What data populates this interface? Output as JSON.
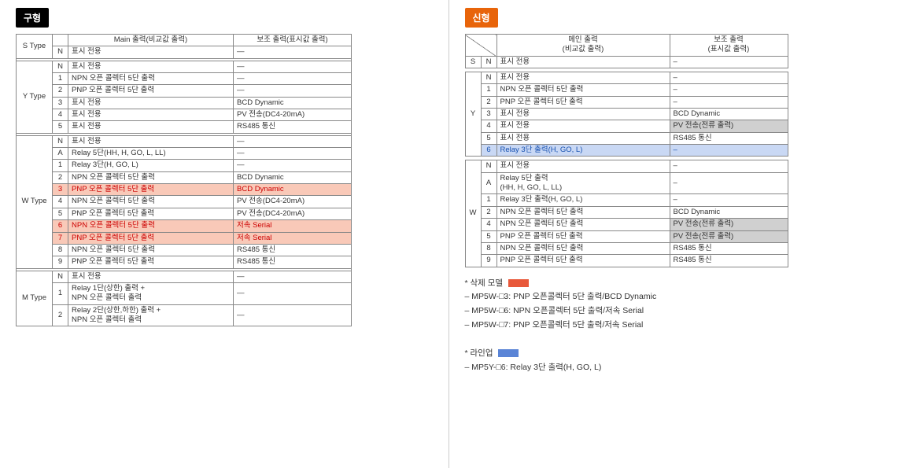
{
  "left": {
    "badge": "구형",
    "header": {
      "main": "Main 출력(비교값 출력)",
      "sub": "보조 출력(표시값 출력)"
    },
    "groups": [
      {
        "type": "S Type",
        "rows": [
          {
            "code": "N",
            "main": "표시 전용",
            "sub": "—"
          }
        ]
      },
      {
        "type": "Y Type",
        "rows": [
          {
            "code": "N",
            "main": "표시 전용",
            "sub": "—"
          },
          {
            "code": "1",
            "main": "NPN 오픈 콜렉터 5단 출력",
            "sub": "—"
          },
          {
            "code": "2",
            "main": "PNP 오픈 콜렉터 5단 출력",
            "sub": "—"
          },
          {
            "code": "3",
            "main": "표시 전용",
            "sub": "BCD Dynamic"
          },
          {
            "code": "4",
            "main": "표시 전용",
            "sub": "PV 전송(DC4-20mA)"
          },
          {
            "code": "5",
            "main": "표시 전용",
            "sub": "RS485 통신"
          }
        ]
      },
      {
        "type": "W Type",
        "rows": [
          {
            "code": "N",
            "main": "표시 전용",
            "sub": "—"
          },
          {
            "code": "A",
            "main": "Relay 5단(HH, H, GO, L, LL)",
            "sub": "—"
          },
          {
            "code": "1",
            "main": "Relay 3단(H, GO, L)",
            "sub": "—"
          },
          {
            "code": "2",
            "main": "NPN 오픈 콜렉터 5단 출력",
            "sub": "BCD Dynamic"
          },
          {
            "code": "3",
            "main": "PNP 오픈 콜렉터 5단 출력",
            "sub": "BCD Dynamic",
            "hl": "red"
          },
          {
            "code": "4",
            "main": "NPN 오픈 콜렉터 5단 출력",
            "sub": "PV 전송(DC4-20mA)"
          },
          {
            "code": "5",
            "main": "PNP 오픈 콜렉터 5단 출력",
            "sub": "PV 전송(DC4-20mA)"
          },
          {
            "code": "6",
            "main": "NPN 오픈 콜렉터 5단 출력",
            "sub": "저속 Serial",
            "hl": "red"
          },
          {
            "code": "7",
            "main": "PNP 오픈 콜렉터 5단 출력",
            "sub": "저속 Serial",
            "hl": "red"
          },
          {
            "code": "8",
            "main": "NPN 오픈 콜렉터 5단 출력",
            "sub": "RS485 통신"
          },
          {
            "code": "9",
            "main": "PNP 오픈 콜렉터 5단 출력",
            "sub": "RS485 통신"
          }
        ]
      },
      {
        "type": "M Type",
        "rows": [
          {
            "code": "N",
            "main": "표시 전용",
            "sub": "—"
          },
          {
            "code": "1",
            "main": "Relay 1단(상한) 출력 +\nNPN 오픈 콜렉터 출력",
            "sub": "—"
          },
          {
            "code": "2",
            "main": "Relay 2단(상한,하한) 출력 +\nNPN 오픈 콜렉터 출력",
            "sub": "—"
          }
        ]
      }
    ]
  },
  "right": {
    "badge": "신형",
    "header": {
      "main": "메인 출력\n(비교값 출력)",
      "sub": "보조 출력\n(표시값 출력)"
    },
    "groups": [
      {
        "type": "S",
        "rows": [
          {
            "code": "N",
            "main": "표시 전용",
            "sub": "–"
          }
        ]
      },
      {
        "type": "Y",
        "rows": [
          {
            "code": "N",
            "main": "표시 전용",
            "sub": "–"
          },
          {
            "code": "1",
            "main": "NPN 오픈 콜렉터 5단 출력",
            "sub": "–"
          },
          {
            "code": "2",
            "main": "PNP 오픈 콜렉터 5단 출력",
            "sub": "–"
          },
          {
            "code": "3",
            "main": "표시 전용",
            "sub": "BCD Dynamic"
          },
          {
            "code": "4",
            "main": "표시 전용",
            "sub": "PV 전송(전류 출력)",
            "shade": true
          },
          {
            "code": "5",
            "main": "표시 전용",
            "sub": "RS485 통신"
          },
          {
            "code": "6",
            "main": "Relay 3단 출력(H, GO, L)",
            "sub": "–",
            "hl": "blue"
          }
        ]
      },
      {
        "type": "W",
        "rows": [
          {
            "code": "N",
            "main": "표시 전용",
            "sub": "–"
          },
          {
            "code": "A",
            "main": "Relay 5단 출력\n(HH, H, GO, L, LL)",
            "sub": "–"
          },
          {
            "code": "1",
            "main": "Relay 3단 출력(H, GO, L)",
            "sub": "–"
          },
          {
            "code": "2",
            "main": "NPN 오픈 콜렉터 5단 출력",
            "sub": "BCD Dynamic"
          },
          {
            "code": "4",
            "main": "NPN 오픈 콜렉터 5단 출력",
            "sub": "PV 전송(전류 출력)",
            "shade": true
          },
          {
            "code": "5",
            "main": "PNP 오픈 콜렉터 5단 출력",
            "sub": "PV 전송(전류 출력)",
            "shade": true
          },
          {
            "code": "8",
            "main": "NPN 오픈 콜렉터 5단 출력",
            "sub": "RS485 통신"
          },
          {
            "code": "9",
            "main": "PNP 오픈 콜렉터 5단 출력",
            "sub": "RS485 통신"
          }
        ]
      }
    ],
    "notes": {
      "del_title": "* 삭제 모델",
      "del_items": [
        "– MP5W-□3: PNP 오픈콜렉터 5단 출력/BCD Dynamic",
        "– MP5W-□6: NPN 오픈콜렉터 5단 출력/저속 Serial",
        "– MP5W-□7: PNP 오픈콜렉터 5단 출력/저속 Serial"
      ],
      "add_title": "* 라인업",
      "add_items": [
        "– MP5Y-□6: Relay 3단 출력(H, GO, L)"
      ]
    }
  }
}
